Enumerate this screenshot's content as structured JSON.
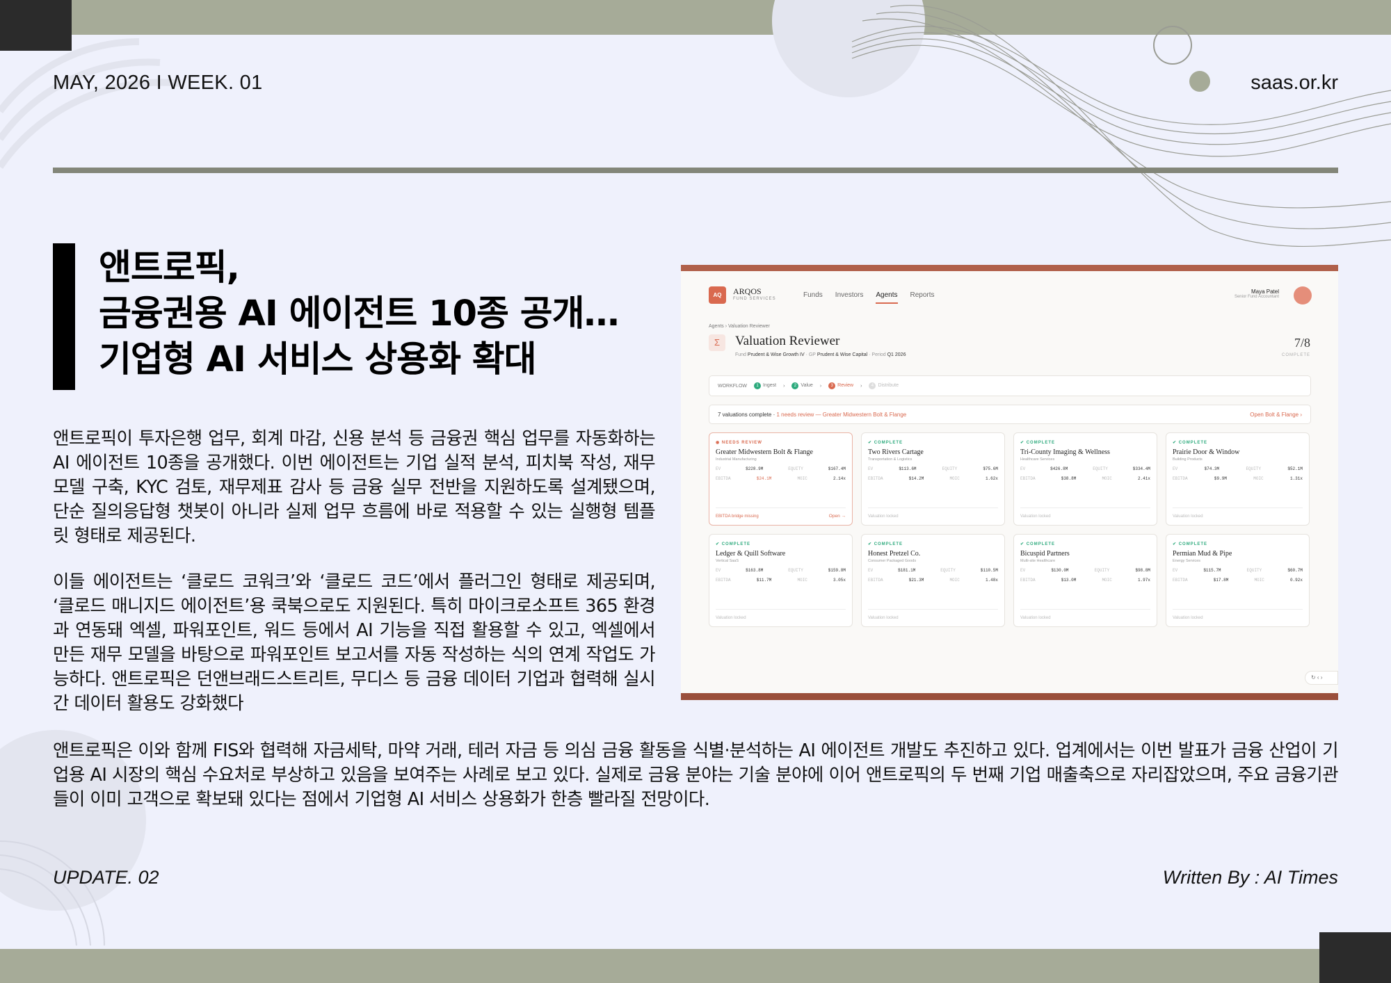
{
  "header": {
    "date_week": "MAY, 2026  I  WEEK. 01",
    "site": "saas.or.kr"
  },
  "headline": {
    "line1": "앤트로픽,",
    "line2": "금융권용 AI 에이전트 10종 공개…",
    "line3": "기업형 AI 서비스 상용화 확대"
  },
  "body": {
    "para1": "앤트로픽이 투자은행 업무, 회계 마감, 신용 분석 등 금융권 핵심 업무를 자동화하는 AI 에이전트 10종을 공개했다. 이번 에이전트는 기업 실적 분석, 피치북 작성, 재무 모델 구축, KYC 검토, 재무제표 감사 등 금융 실무 전반을 지원하도록 설계됐으며, 단순 질의응답형 챗봇이 아니라 실제 업무 흐름에 바로 적용할 수 있는 실행형 템플릿 형태로 제공된다.",
    "para2": "이들 에이전트는 ‘클로드 코워크’와 ‘클로드 코드’에서 플러그인 형태로 제공되며, ‘클로드 매니지드 에이전트’용 쿡북으로도 지원된다. 특히 마이크로소프트 365 환경과 연동돼 엑셀, 파워포인트, 워드 등에서 AI 기능을 직접 활용할 수 있고, 엑셀에서 만든 재무 모델을 바탕으로 파워포인트 보고서를 자동 작성하는 식의 연계 작업도 가능하다. 앤트로픽은 던앤브래드스트리트, 무디스 등 금융 데이터 기업과 협력해 실시간 데이터 활용도 강화했다",
    "para3": "앤트로픽은 이와 함께 FIS와 협력해 자금세탁, 마약 거래, 테러 자금 등 의심 금융 활동을 식별·분석하는 AI 에이전트 개발도 추진하고 있다. 업계에서는 이번 발표가 금융 산업이 기업용 AI 시장의 핵심 수요처로 부상하고 있음을 보여주는 사례로 보고 있다. 실제로 금융 분야는 기술 분야에 이어 앤트로픽의 두 번째 기업 매출축으로 자리잡았으며, 주요 금융기관들이 이미 고객으로 확보돼 있다는 점에서 기업형 AI 서비스 상용화가 한층 빨라질 전망이다."
  },
  "footer": {
    "left": "UPDATE. 02",
    "right": "Written By : AI Times"
  },
  "screenshot": {
    "logo": "AQ",
    "brand": "ARQOS",
    "brand_sub": "FUND SERVICES",
    "nav": [
      "Funds",
      "Investors",
      "Agents",
      "Reports"
    ],
    "user_name": "Maya Patel",
    "user_role": "Senior Fund Accountant",
    "breadcrumb": "Agents  ›  Valuation Reviewer",
    "title": "Valuation Reviewer",
    "fund_label": "Fund",
    "fund": "Prudent & Wise Growth IV",
    "gp_label": "GP",
    "gp": "Prudent & Wise Capital",
    "period_label": "Period",
    "period": "Q1 2026",
    "count": "7/8",
    "count_label": "COMPLETE",
    "workflow_label": "WORKFLOW",
    "steps": [
      "Ingest",
      "Value",
      "Review",
      "Distribute"
    ],
    "banner_main": "7 valuations complete · ",
    "banner_warn": "1 needs review — Greater Midwestern Bolt & Flange",
    "banner_link": "Open Bolt & Flange  ›",
    "cards": [
      {
        "status": "NEEDS REVIEW",
        "name": "Greater Midwestern Bolt & Flange",
        "industry": "Industrial Manufacturing",
        "ev": "$228.9M",
        "equity": "$167.4M",
        "ebitda": "$24.1M",
        "moic": "2.14x",
        "foot": "EBITDA bridge missing",
        "open": "Open →"
      },
      {
        "status": "COMPLETE",
        "name": "Two Rivers Cartage",
        "industry": "Transportation & Logistics",
        "ev": "$113.6M",
        "equity": "$75.6M",
        "ebitda": "$14.2M",
        "moic": "1.62x",
        "foot": "Valuation locked",
        "open": ""
      },
      {
        "status": "COMPLETE",
        "name": "Tri-County Imaging & Wellness",
        "industry": "Healthcare Services",
        "ev": "$426.8M",
        "equity": "$334.4M",
        "ebitda": "$38.8M",
        "moic": "2.41x",
        "foot": "Valuation locked",
        "open": ""
      },
      {
        "status": "COMPLETE",
        "name": "Prairie Door & Window",
        "industry": "Building Products",
        "ev": "$74.3M",
        "equity": "$52.1M",
        "ebitda": "$9.9M",
        "moic": "1.31x",
        "foot": "Valuation locked",
        "open": ""
      },
      {
        "status": "COMPLETE",
        "name": "Ledger & Quill Software",
        "industry": "Vertical SaaS",
        "ev": "$163.8M",
        "equity": "$159.8M",
        "ebitda": "$11.7M",
        "moic": "3.05x",
        "foot": "Valuation locked",
        "open": ""
      },
      {
        "status": "COMPLETE",
        "name": "Honest Pretzel Co.",
        "industry": "Consumer Packaged Goods",
        "ev": "$181.1M",
        "equity": "$110.5M",
        "ebitda": "$21.3M",
        "moic": "1.48x",
        "foot": "Valuation locked",
        "open": ""
      },
      {
        "status": "COMPLETE",
        "name": "Bicuspid Partners",
        "industry": "Multi-site Healthcare",
        "ev": "$130.0M",
        "equity": "$98.8M",
        "ebitda": "$13.0M",
        "moic": "1.97x",
        "foot": "Valuation locked",
        "open": ""
      },
      {
        "status": "COMPLETE",
        "name": "Permian Mud & Pipe",
        "industry": "Energy Services",
        "ev": "$115.7M",
        "equity": "$60.7M",
        "ebitda": "$17.8M",
        "moic": "0.92x",
        "foot": "Valuation locked",
        "open": ""
      }
    ],
    "row_labels": {
      "ev": "EV",
      "equity": "EQUITY",
      "ebitda": "EBITDA",
      "moic": "MOIC"
    },
    "pager": "↻  ‹  ›"
  }
}
